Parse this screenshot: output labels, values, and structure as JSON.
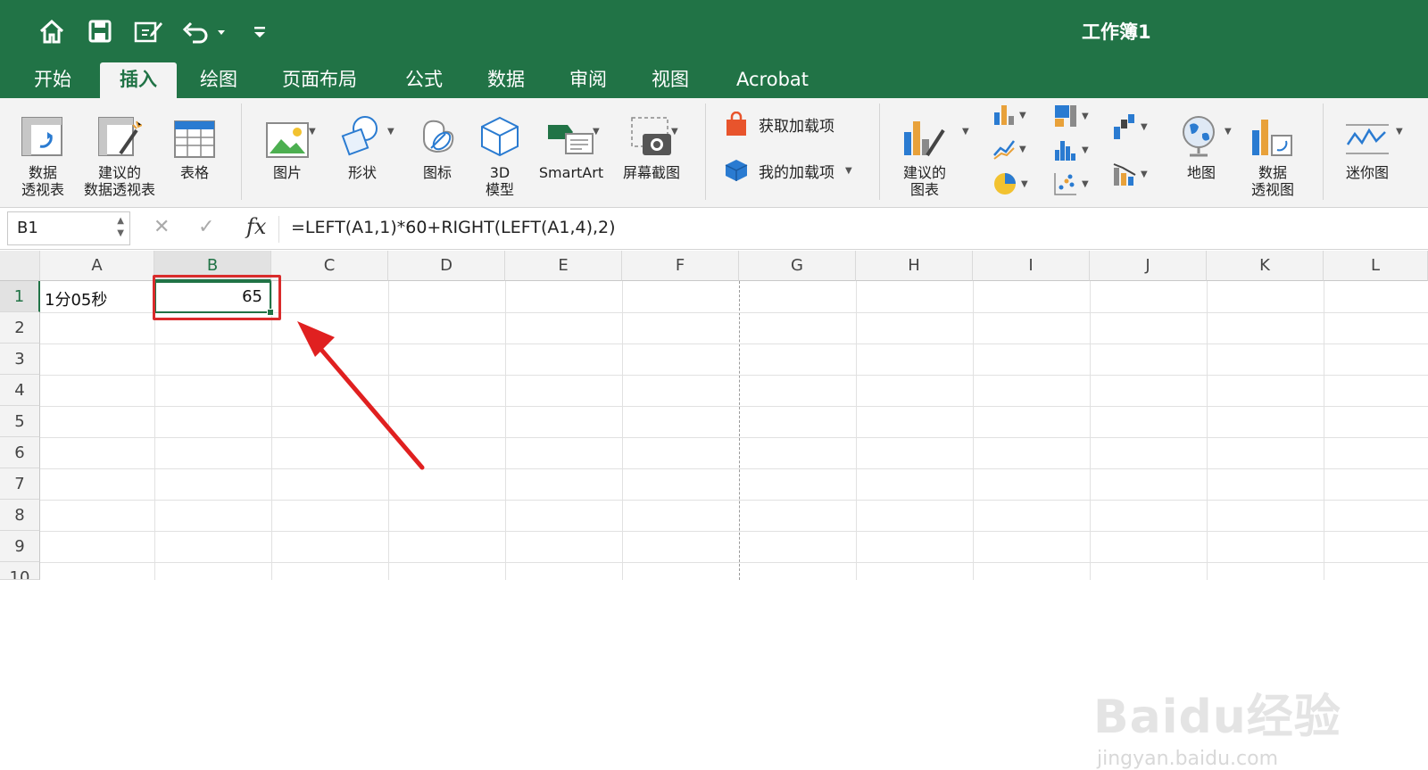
{
  "window": {
    "title": "工作簿1"
  },
  "quick_access": [
    "home-icon",
    "save-icon",
    "edit-icon",
    "undo-icon",
    "customize-icon"
  ],
  "tabs": [
    {
      "label": "开始"
    },
    {
      "label": "插入",
      "active": true
    },
    {
      "label": "绘图"
    },
    {
      "label": "页面布局"
    },
    {
      "label": "公式"
    },
    {
      "label": "数据"
    },
    {
      "label": "审阅"
    },
    {
      "label": "视图"
    },
    {
      "label": "Acrobat"
    }
  ],
  "ribbon": {
    "pivot_table": {
      "line1": "数据",
      "line2": "透视表"
    },
    "recommended_pivot": {
      "line1": "建议的",
      "line2": "数据透视表"
    },
    "table": "表格",
    "pictures": "图片",
    "shapes": "形状",
    "icons": "图标",
    "model3d": {
      "line1": "3D",
      "line2": "模型"
    },
    "smartart": "SmartArt",
    "screenshot": "屏幕截图",
    "get_addins": "获取加载项",
    "my_addins": "我的加载项",
    "recommended_charts": {
      "line1": "建议的",
      "line2": "图表"
    },
    "maps": "地图",
    "pivot_chart": {
      "line1": "数据",
      "line2": "透视图"
    },
    "sparklines": "迷你图"
  },
  "formula_bar": {
    "name_box": "B1",
    "fx": "fx",
    "formula": "=LEFT(A1,1)*60+RIGHT(LEFT(A1,4),2)"
  },
  "columns": [
    "A",
    "B",
    "C",
    "D",
    "E",
    "F",
    "G",
    "H",
    "I",
    "J",
    "K",
    "L"
  ],
  "selected_column": "B",
  "rows": [
    "1",
    "2",
    "3",
    "4",
    "5",
    "6",
    "7",
    "8",
    "9",
    "10"
  ],
  "selected_row": "1",
  "cells": {
    "A1": "1分05秒",
    "B1": "65"
  },
  "watermark": {
    "brand": "Baidu经验",
    "url": "jingyan.baidu.com"
  },
  "colors": {
    "excel_green": "#217346",
    "annotation_red": "#d92b2b"
  }
}
